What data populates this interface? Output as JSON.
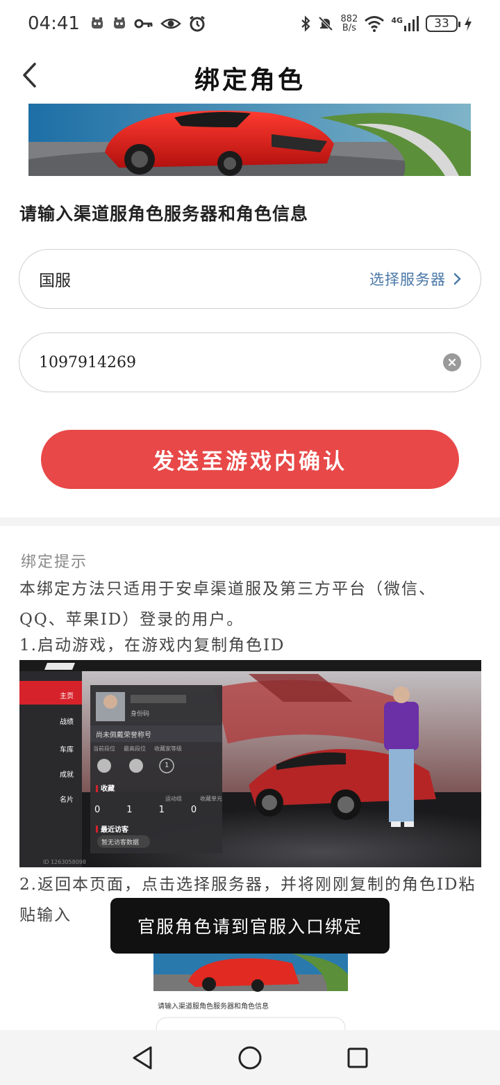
{
  "status_bar": {
    "time": "04:41",
    "net_speed_value": "882",
    "net_speed_unit": "B/s",
    "network": "4G",
    "battery": "33"
  },
  "header": {
    "title": "绑定角色",
    "back_icon": "chevron-left-icon"
  },
  "form": {
    "section_title": "请输入渠道服角色服务器和角色信息",
    "server_value": "国服",
    "server_select_label": "选择服务器",
    "role_id_value": "1097914269",
    "confirm_label": "发送至游戏内确认"
  },
  "tips": {
    "heading": "绑定提示",
    "paragraph": "本绑定方法只适用于安卓渠道服及第三方平台（微信、QQ、苹果ID）登录的用户。",
    "step1": "1.启动游戏，在游戏内复制角色ID",
    "step2": "2.返回本页面，点击选择服务器，并将刚刚复制的角色ID粘贴输入"
  },
  "game_screenshot": {
    "nav_items": [
      "主页",
      "战绩",
      "车库",
      "成就",
      "名片"
    ],
    "id_label": "身份码",
    "honor_title": "尚未佩戴荣誉称号",
    "rank_labels": [
      "当前段位",
      "最高段位",
      "收藏家等级"
    ],
    "collector_level": "1",
    "collection_title": "收藏",
    "collection_stats": [
      {
        "label": "运动组",
        "value": "1"
      },
      {
        "label": "收藏单元",
        "value": "0"
      }
    ],
    "collection_first_values": [
      "0",
      "1"
    ],
    "visitors_title": "最近访客",
    "visitors_empty": "暂无访客数据",
    "footer_id": "ID 1263058098"
  },
  "toast": {
    "message": "官服角色请到官服入口绑定"
  },
  "mini_screenshot": {
    "caption": "请输入渠道服角色服务器和角色信息"
  },
  "colors": {
    "accent_red": "#e84848",
    "link_blue": "#4a78a8",
    "toast_bg": "#111111"
  }
}
